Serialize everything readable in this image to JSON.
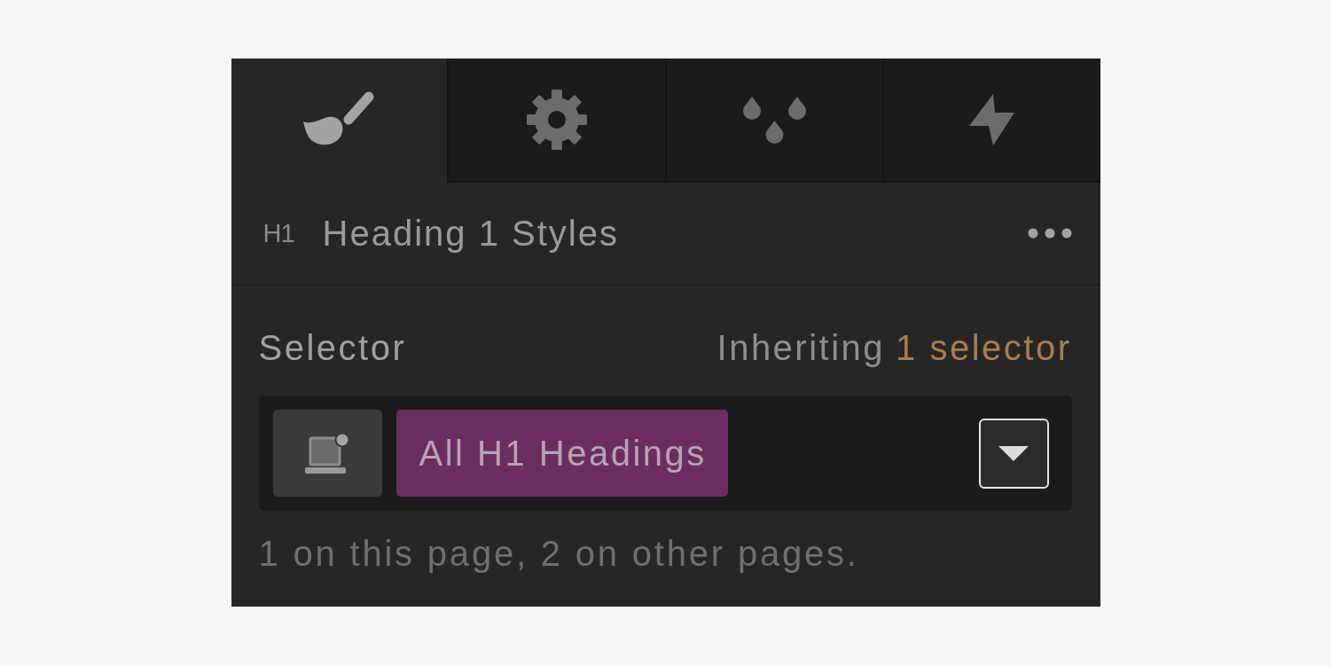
{
  "tabs": [
    {
      "kind": "brush",
      "selected": true
    },
    {
      "kind": "gear",
      "selected": false
    },
    {
      "kind": "drops",
      "selected": false
    },
    {
      "kind": "bolt",
      "selected": false
    }
  ],
  "header": {
    "badge": "H1",
    "title": "Heading 1 Styles"
  },
  "selector": {
    "label": "Selector",
    "inheriting": "Inheriting",
    "inheriting_link": "1 selector",
    "tag": "All H1 Headings",
    "note": "1 on this page, 2 on other pages."
  }
}
